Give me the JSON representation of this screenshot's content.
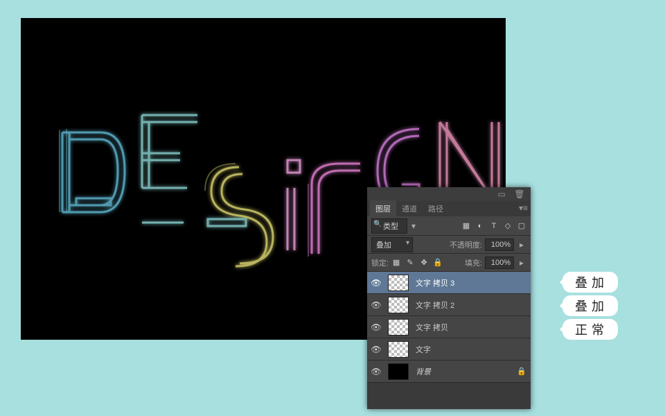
{
  "panel": {
    "tabs": [
      "图层",
      "通道",
      "路径"
    ],
    "active_tab": 0,
    "kind_label": "类型",
    "filter_icons": [
      "image-icon",
      "adjustment-icon",
      "type-icon",
      "shape-icon",
      "smartobject-icon"
    ],
    "blend_mode": "叠加",
    "opacity_label": "不透明度:",
    "opacity_value": "100%",
    "lock_label": "锁定:",
    "lock_icons": [
      "lock-transparency-icon",
      "lock-paint-icon",
      "lock-position-icon",
      "lock-all-icon"
    ],
    "fill_label": "填充:",
    "fill_value": "100%",
    "layers": [
      {
        "name": "文字 拷贝 3",
        "thumb": "checker",
        "locked": false,
        "selected": true
      },
      {
        "name": "文字 拷贝 2",
        "thumb": "checker",
        "locked": false,
        "selected": false
      },
      {
        "name": "文字 拷贝",
        "thumb": "checker",
        "locked": false,
        "selected": false
      },
      {
        "name": "文字",
        "thumb": "checker",
        "locked": false,
        "selected": false
      },
      {
        "name": "背景",
        "thumb": "black",
        "locked": true,
        "selected": false
      }
    ]
  },
  "callouts": [
    "叠加",
    "叠加",
    "正常"
  ],
  "artwork_text": "DESIGN",
  "colors": {
    "page_bg": "#a7e0df",
    "canvas_bg": "#000000",
    "panel_bg": "#454545",
    "selected_layer": "#5f7896"
  }
}
